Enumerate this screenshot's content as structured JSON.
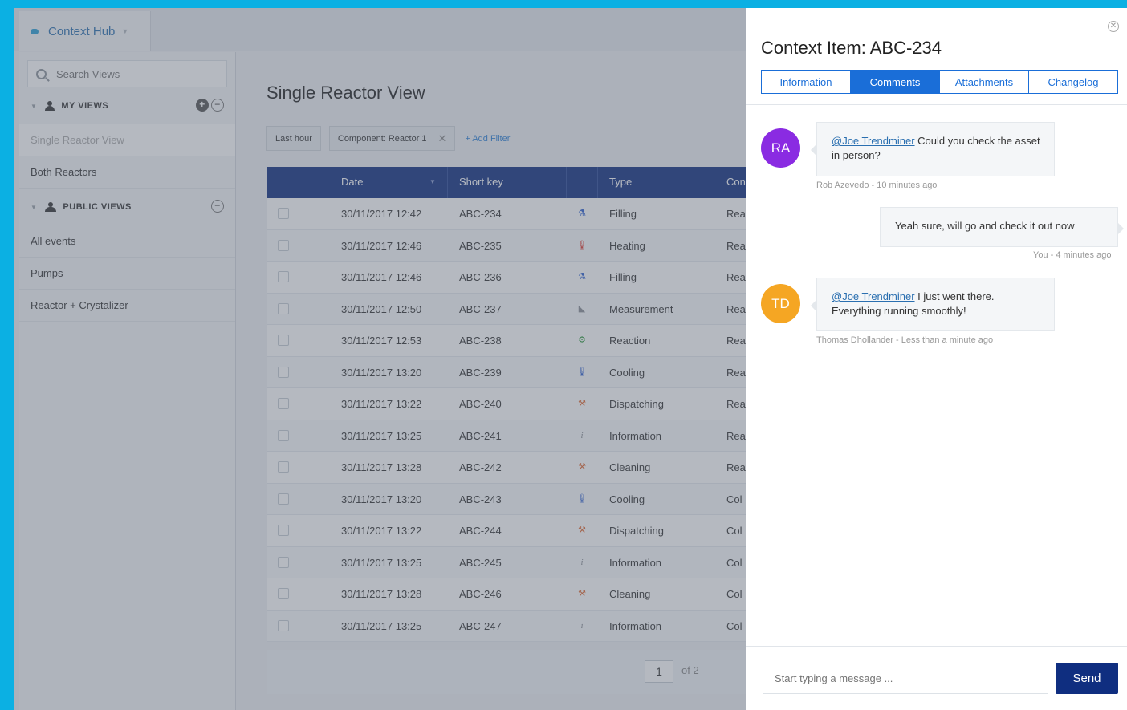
{
  "app": {
    "brand": "Context Hub"
  },
  "sidebar": {
    "search_placeholder": "Search Views",
    "my_views": {
      "title": "MY VIEWS",
      "items": [
        "Single Reactor View",
        "Both Reactors"
      ]
    },
    "public_views": {
      "title": "PUBLIC VIEWS",
      "items": [
        "All events",
        "Pumps",
        "Reactor + Crystalizer"
      ]
    }
  },
  "main": {
    "title": "Single Reactor View",
    "filters": {
      "time": "Last hour",
      "component": "Component: Reactor 1",
      "add": "+ Add Filter"
    },
    "columns": {
      "date": "Date",
      "short_key": "Short key",
      "type": "Type",
      "col4": "Con"
    },
    "rows": [
      {
        "date": "30/11/2017 12:42",
        "key": "ABC-234",
        "type": "Filling",
        "col4": "Rea",
        "icon": "flask-icon",
        "color": "#2d5fcf"
      },
      {
        "date": "30/11/2017 12:46",
        "key": "ABC-235",
        "type": "Heating",
        "col4": "Rea",
        "icon": "thermometer-icon",
        "color": "#e03a2f"
      },
      {
        "date": "30/11/2017 12:46",
        "key": "ABC-236",
        "type": "Filling",
        "col4": "Rea",
        "icon": "flask-icon",
        "color": "#2d5fcf"
      },
      {
        "date": "30/11/2017 12:50",
        "key": "ABC-237",
        "type": "Measurement",
        "col4": "Rea",
        "icon": "ruler-icon",
        "color": "#8a8f96"
      },
      {
        "date": "30/11/2017 12:53",
        "key": "ABC-238",
        "type": "Reaction",
        "col4": "Rea",
        "icon": "gear-icon",
        "color": "#2f9a3e"
      },
      {
        "date": "30/11/2017 13:20",
        "key": "ABC-239",
        "type": "Cooling",
        "col4": "Rea",
        "icon": "thermometer-icon",
        "color": "#2d5fcf"
      },
      {
        "date": "30/11/2017 13:22",
        "key": "ABC-240",
        "type": "Dispatching",
        "col4": "Rea",
        "icon": "hammer-icon",
        "color": "#e0662f"
      },
      {
        "date": "30/11/2017 13:25",
        "key": "ABC-241",
        "type": "Information",
        "col4": "Rea",
        "icon": "info-icon",
        "color": "#8a8f96"
      },
      {
        "date": "30/11/2017 13:28",
        "key": "ABC-242",
        "type": "Cleaning",
        "col4": "Rea",
        "icon": "hammer-icon",
        "color": "#e0662f"
      },
      {
        "date": "30/11/2017 13:20",
        "key": "ABC-243",
        "type": "Cooling",
        "col4": "Col",
        "icon": "thermometer-icon",
        "color": "#2d5fcf"
      },
      {
        "date": "30/11/2017 13:22",
        "key": "ABC-244",
        "type": "Dispatching",
        "col4": "Col",
        "icon": "hammer-icon",
        "color": "#e0662f"
      },
      {
        "date": "30/11/2017 13:25",
        "key": "ABC-245",
        "type": "Information",
        "col4": "Col",
        "icon": "info-icon",
        "color": "#8a8f96"
      },
      {
        "date": "30/11/2017 13:28",
        "key": "ABC-246",
        "type": "Cleaning",
        "col4": "Col",
        "icon": "hammer-icon",
        "color": "#e0662f"
      },
      {
        "date": "30/11/2017 13:25",
        "key": "ABC-247",
        "type": "Information",
        "col4": "Col",
        "icon": "info-icon",
        "color": "#8a8f96"
      }
    ],
    "pager": {
      "page": "1",
      "of": "of 2"
    }
  },
  "panel": {
    "title": "Context Item: ABC-234",
    "tabs": [
      "Information",
      "Comments",
      "Attachments",
      "Changelog"
    ],
    "active_tab": "Comments",
    "comments": [
      {
        "initials": "RA",
        "color": "#8a2be2",
        "mention": "@Joe Trendminer",
        "text": " Could you check the asset in person?",
        "meta": "Rob Azevedo - 10 minutes ago"
      },
      {
        "own": true,
        "text": "Yeah sure, will go and check it out now",
        "meta": "You - 4 minutes ago"
      },
      {
        "initials": "TD",
        "color": "#f5a623",
        "mention": "@Joe Trendminer",
        "text": " I just went there. Everything running smoothly!",
        "meta": "Thomas Dhollander - Less than a minute ago"
      }
    ],
    "compose": {
      "placeholder": "Start typing a message ...",
      "send": "Send"
    }
  }
}
